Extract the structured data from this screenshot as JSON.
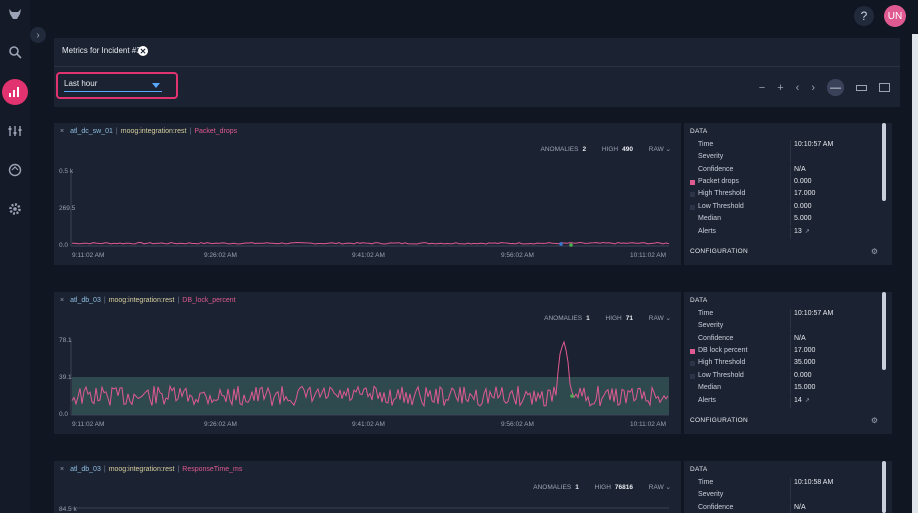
{
  "topbar": {
    "help": "?",
    "avatar": "UN"
  },
  "sidebar": {
    "expander": "›"
  },
  "header": {
    "title": "Metrics for Incident #3",
    "close": "✕"
  },
  "toolbar": {
    "range_value": "Last hour",
    "controls": [
      "−",
      "+",
      "‹",
      "›",
      "—"
    ]
  },
  "panels": [
    {
      "close": "×",
      "host": "atl_dc_sw_01",
      "source": "moog:integration:rest",
      "metric": "Packet_drops",
      "anomalies_label": "ANOMALIES",
      "anomalies": "2",
      "high_label": "HIGH",
      "high": "490",
      "mode": "RAW",
      "y_ticks": [
        "0.5 k",
        "269.5",
        "0.0"
      ],
      "x_ticks": [
        "9:11:02 AM",
        "9:26:02 AM",
        "9:41:02 AM",
        "9:56:02 AM",
        "10:11:02 AM"
      ],
      "data": {
        "section": "DATA",
        "rows": [
          {
            "label": "Time",
            "value": "10:10:57 AM"
          },
          {
            "label": "Severity",
            "value": ""
          },
          {
            "label": "Confidence",
            "value": "N/A"
          },
          {
            "label": "Packet drops",
            "value": "0.000"
          },
          {
            "label": "High Threshold",
            "value": "17.000"
          },
          {
            "label": "Low Threshold",
            "value": "0.000"
          },
          {
            "label": "Median",
            "value": "5.000"
          },
          {
            "label": "Alerts",
            "value": "13"
          }
        ],
        "config": "CONFIGURATION"
      }
    },
    {
      "close": "×",
      "host": "atl_db_03",
      "source": "moog:integration:rest",
      "metric": "DB_lock_percent",
      "anomalies_label": "ANOMALIES",
      "anomalies": "1",
      "high_label": "HIGH",
      "high": "71",
      "mode": "RAW",
      "y_ticks": [
        "78.1",
        "39.1",
        "0.0"
      ],
      "x_ticks": [
        "9:11:02 AM",
        "9:26:02 AM",
        "9:41:02 AM",
        "9:56:02 AM",
        "10:11:02 AM"
      ],
      "data": {
        "section": "DATA",
        "rows": [
          {
            "label": "Time",
            "value": "10:10:57 AM"
          },
          {
            "label": "Severity",
            "value": ""
          },
          {
            "label": "Confidence",
            "value": "N/A"
          },
          {
            "label": "DB lock percent",
            "value": "17.000"
          },
          {
            "label": "High Threshold",
            "value": "35.000"
          },
          {
            "label": "Low Threshold",
            "value": "0.000"
          },
          {
            "label": "Median",
            "value": "15.000"
          },
          {
            "label": "Alerts",
            "value": "14"
          }
        ],
        "config": "CONFIGURATION"
      }
    },
    {
      "close": "×",
      "host": "atl_db_03",
      "source": "moog:integration:rest",
      "metric": "ResponseTime_ms",
      "anomalies_label": "ANOMALIES",
      "anomalies": "1",
      "high_label": "HIGH",
      "high": "76816",
      "mode": "RAW",
      "y_ticks": [
        "84.5 k"
      ],
      "data": {
        "section": "DATA",
        "rows": [
          {
            "label": "Time",
            "value": "10:10:58 AM"
          },
          {
            "label": "Severity",
            "value": ""
          },
          {
            "label": "Confidence",
            "value": "N/A"
          }
        ]
      }
    }
  ],
  "colors": {
    "accent": "#e0336f",
    "series": "#e05a92",
    "band": "#2f4a4f",
    "active_nav": "#e0336f"
  }
}
